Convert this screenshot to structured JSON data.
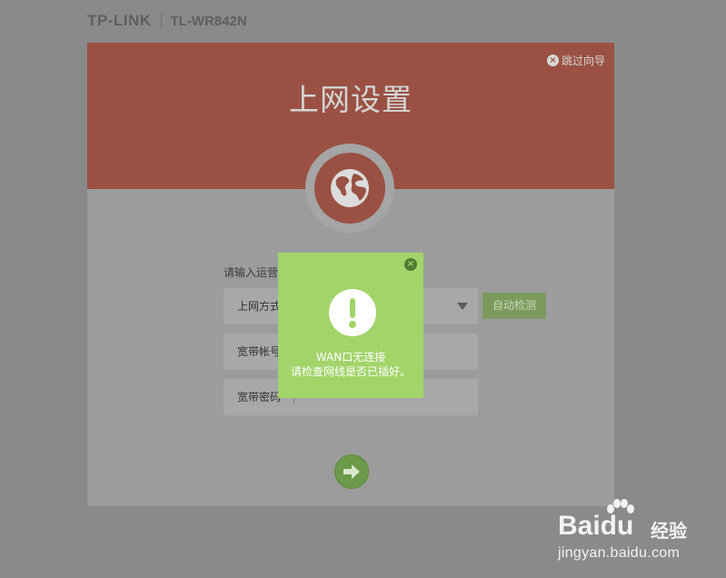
{
  "brand": {
    "logo": "TP-LINK",
    "model": "TL-WR842N"
  },
  "wizard": {
    "skip_label": "跳过向导",
    "title": "上网设置",
    "prompt_label": "请输入运营",
    "rows": [
      {
        "label": "上网方式",
        "value": ""
      },
      {
        "label": "宽带帐号",
        "value": ""
      },
      {
        "label": "宽带密码",
        "value": ""
      }
    ],
    "auto_detect_label": "自动检测"
  },
  "modal": {
    "line1": "WAN口无连接",
    "line2": "请检查网线是否已插好。"
  },
  "watermark": {
    "logo": "Baidu",
    "jingyan": "经验",
    "url": "jingyan.baidu.com"
  },
  "icons": {
    "skip": "close-circle-icon",
    "header": "globe-icon",
    "alert": "exclamation-icon",
    "next": "arrow-right-icon",
    "close": "close-circle-icon"
  },
  "colors": {
    "header_bg": "#9a5143",
    "modal_bg": "#a2d46a",
    "button_green": "#7c9a5e",
    "overlay_bg": "#8a8a8a"
  }
}
